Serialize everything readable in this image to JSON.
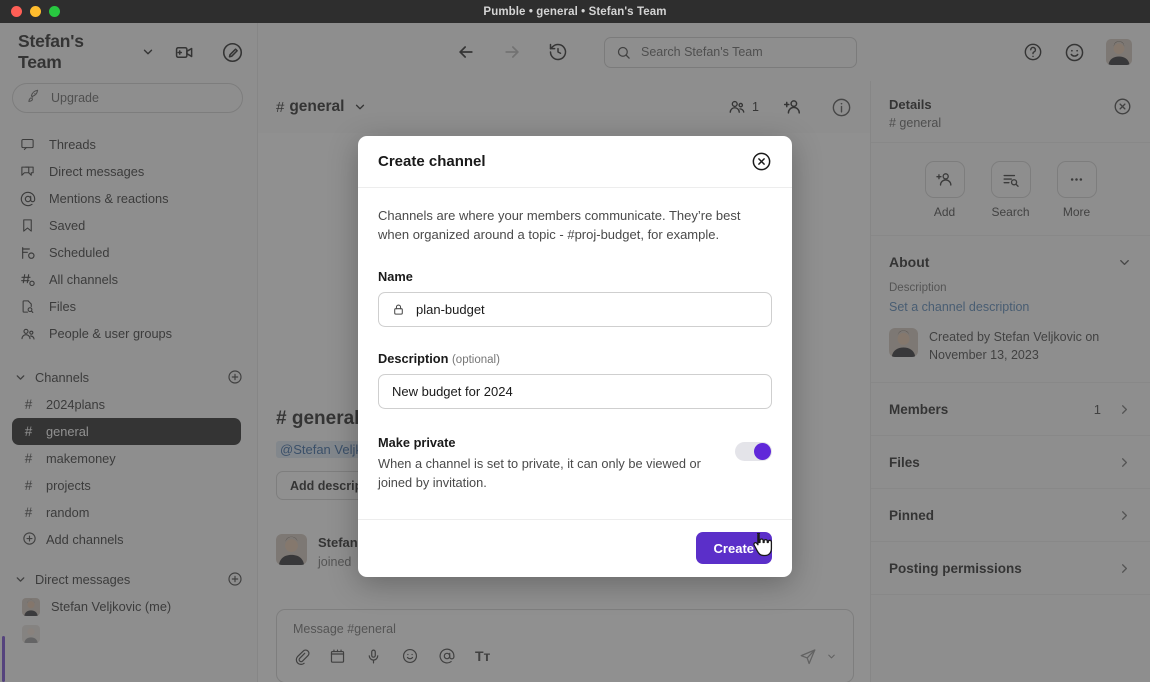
{
  "window": {
    "title": "Pumble • general • Stefan's Team"
  },
  "sidebar": {
    "workspace_name": "Stefan's Team",
    "upgrade_label": "Upgrade",
    "nav_items": [
      {
        "label": "Threads",
        "icon": "threads-icon"
      },
      {
        "label": "Direct messages",
        "icon": "direct-messages-icon"
      },
      {
        "label": "Mentions & reactions",
        "icon": "mentions-icon"
      },
      {
        "label": "Saved",
        "icon": "bookmark-icon"
      },
      {
        "label": "Scheduled",
        "icon": "scheduled-icon"
      },
      {
        "label": "All channels",
        "icon": "all-channels-icon"
      },
      {
        "label": "Files",
        "icon": "files-icon"
      },
      {
        "label": "People & user groups",
        "icon": "people-icon"
      }
    ],
    "channels_section": {
      "title": "Channels",
      "items": [
        {
          "label": "2024plans",
          "active": false
        },
        {
          "label": "general",
          "active": true
        },
        {
          "label": "makemoney",
          "active": false
        },
        {
          "label": "projects",
          "active": false
        },
        {
          "label": "random",
          "active": false
        }
      ],
      "add_label": "Add channels"
    },
    "dm_section": {
      "title": "Direct messages",
      "items": [
        {
          "label": "Stefan Veljkovic (me)"
        }
      ]
    }
  },
  "topbar": {
    "search_placeholder": "Search Stefan's Team"
  },
  "channel_header": {
    "hash": "#",
    "name": "general",
    "member_count": "1"
  },
  "message_area": {
    "welcome_title": "# general",
    "mention_chip": "@Stefan Veljk",
    "add_description_label": "Add descriptio",
    "message": {
      "author": "Stefan",
      "text": "joined"
    },
    "composer_placeholder": "Message #general"
  },
  "details": {
    "title": "Details",
    "subtitle": "# general",
    "actions": [
      {
        "label": "Add",
        "icon": "add-person-icon"
      },
      {
        "label": "Search",
        "icon": "search-list-icon"
      },
      {
        "label": "More",
        "icon": "more-dots-icon"
      }
    ],
    "about_title": "About",
    "description_label": "Description",
    "description_link": "Set a channel description",
    "created_text": "Created by Stefan Veljkovic on November 13, 2023",
    "rows": [
      {
        "label": "Members",
        "count": "1"
      },
      {
        "label": "Files",
        "count": ""
      },
      {
        "label": "Pinned",
        "count": ""
      },
      {
        "label": "Posting permissions",
        "count": ""
      }
    ]
  },
  "modal": {
    "title": "Create channel",
    "description": "Channels are where your members communicate. They’re best when organized around a topic - #proj-budget, for example.",
    "name_label": "Name",
    "name_value": "plan-budget",
    "description_label": "Description",
    "description_optional": "(optional)",
    "description_value": "New budget for 2024",
    "private_title": "Make private",
    "private_body": "When a channel is set to private, it can only be viewed or joined by invitation.",
    "private_enabled": true,
    "create_label": "Create"
  },
  "colors": {
    "accent": "#5b2fc9",
    "toggle_on": "#6028d9",
    "active_channel_bg": "#1a1a1a",
    "link": "#4d7fb5"
  }
}
